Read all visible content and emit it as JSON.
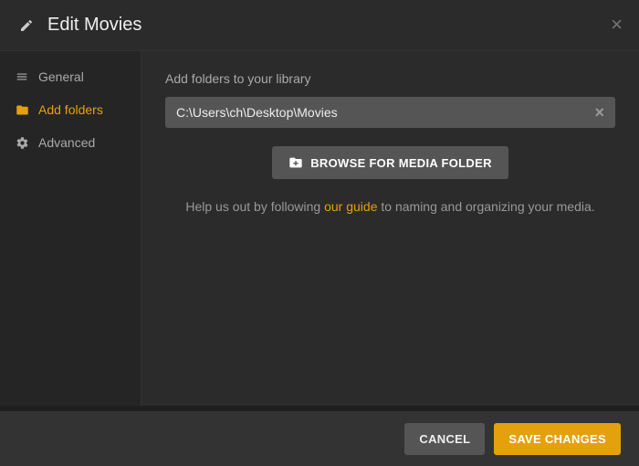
{
  "header": {
    "title": "Edit Movies"
  },
  "sidebar": {
    "items": [
      {
        "label": "General"
      },
      {
        "label": "Add folders"
      },
      {
        "label": "Advanced"
      }
    ]
  },
  "main": {
    "label": "Add folders to your library",
    "path": "C:\\Users\\ch\\Desktop\\Movies",
    "browse_label": "BROWSE FOR MEDIA FOLDER",
    "help_pre": "Help us out by following ",
    "help_link": "our guide",
    "help_post": " to naming and organizing your media."
  },
  "footer": {
    "cancel": "CANCEL",
    "save": "SAVE CHANGES"
  }
}
